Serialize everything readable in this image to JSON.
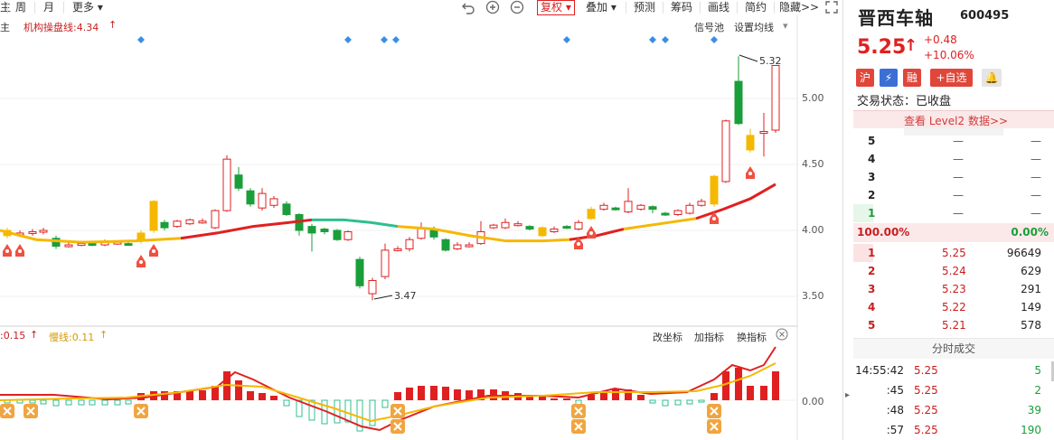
{
  "toolbar": {
    "zhu": "主",
    "week": "周",
    "month": "月",
    "more": "更多",
    "fuquan": "复权",
    "diejia": "叠加",
    "yuce": "预测",
    "chouma": "筹码",
    "huaxian": "画线",
    "jianyue": "简约",
    "yincang": "隐藏>>"
  },
  "indicator": {
    "name": "机构操盘线:4.34",
    "zhu_label": "主",
    "signal_pool": "信号池",
    "set_ma": "设置均线"
  },
  "price_axis": [
    "5.00",
    "4.50",
    "4.00",
    "3.50"
  ],
  "annotations": {
    "high": "5.32",
    "low": "3.47"
  },
  "lower": {
    "fast_label": ":0.15",
    "slow_label": "慢线:0.11",
    "gaizuobiao": "改坐标",
    "jiazhibiao": "加指标",
    "huanzhibiao": "换指标",
    "zero": "0.00"
  },
  "colors": {
    "up": "#e02020",
    "down": "#1a9e3a",
    "accent": "#f5b800",
    "teal": "#2fbf8f"
  },
  "stock": {
    "name": "晋西车轴",
    "code": "600495",
    "price": "5.25",
    "change": "+0.48",
    "change_pct": "+10.06%",
    "status": "交易状态：已收盘",
    "level2": "查看 Level2 数据>>",
    "badges": [
      "沪",
      "融",
      "+自选"
    ]
  },
  "order_book_sell": [
    {
      "level": "5",
      "price": "—",
      "vol": "—"
    },
    {
      "level": "4",
      "price": "—",
      "vol": "—"
    },
    {
      "level": "3",
      "price": "—",
      "vol": "—"
    },
    {
      "level": "2",
      "price": "—",
      "vol": "—"
    },
    {
      "level": "1",
      "price": "—",
      "vol": "—"
    }
  ],
  "ratio": {
    "left": "100.00%",
    "right": "0.00%"
  },
  "order_book_buy": [
    {
      "level": "1",
      "price": "5.25",
      "vol": "96649"
    },
    {
      "level": "2",
      "price": "5.24",
      "vol": "629"
    },
    {
      "level": "3",
      "price": "5.23",
      "vol": "291"
    },
    {
      "level": "4",
      "price": "5.22",
      "vol": "149"
    },
    {
      "level": "5",
      "price": "5.21",
      "vol": "578"
    }
  ],
  "ticks_title": "分时成交",
  "ticks": [
    {
      "time": "14:55:42",
      "price": "5.25",
      "vol": "5"
    },
    {
      "time": ":45",
      "price": "5.25",
      "vol": "2"
    },
    {
      "time": ":48",
      "price": "5.25",
      "vol": "39"
    },
    {
      "time": ":57",
      "price": "5.25",
      "vol": "190"
    }
  ]
}
